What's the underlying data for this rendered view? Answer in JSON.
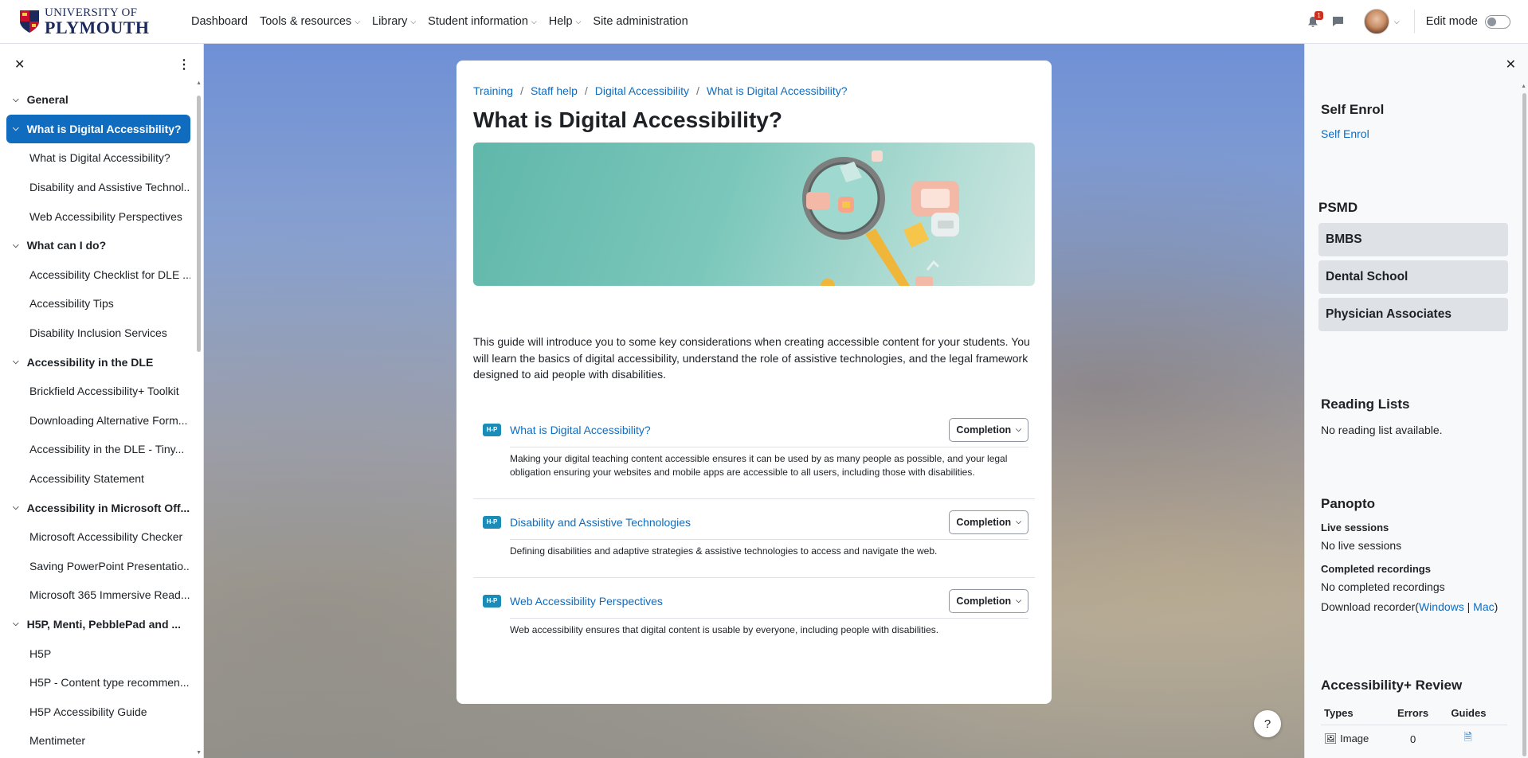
{
  "navbar": {
    "logo_line1": "UNIVERSITY OF",
    "logo_line2": "PLYMOUTH",
    "items": [
      {
        "label": "Dashboard",
        "dropdown": false
      },
      {
        "label": "Tools & resources",
        "dropdown": true
      },
      {
        "label": "Library",
        "dropdown": true
      },
      {
        "label": "Student information",
        "dropdown": true
      },
      {
        "label": "Help",
        "dropdown": true
      },
      {
        "label": "Site administration",
        "dropdown": false
      }
    ],
    "notification_count": "1",
    "edit_mode_label": "Edit mode"
  },
  "course_index": {
    "sections": [
      {
        "title": "General",
        "active": false,
        "items": []
      },
      {
        "title": "What is Digital Accessibility?",
        "active": true,
        "items": [
          "What is Digital Accessibility?",
          "Disability and Assistive Technol...",
          "Web Accessibility Perspectives"
        ]
      },
      {
        "title": "What can I do?",
        "active": false,
        "items": [
          "Accessibility Checklist for DLE ...",
          "Accessibility Tips",
          "Disability Inclusion Services"
        ]
      },
      {
        "title": "Accessibility in the DLE",
        "active": false,
        "items": [
          "Brickfield Accessibility+ Toolkit",
          "Downloading Alternative Form...",
          "Accessibility in the DLE - Tiny...",
          "Accessibility Statement"
        ]
      },
      {
        "title": "Accessibility in Microsoft Off...",
        "active": false,
        "items": [
          "Microsoft Accessibility Checker",
          "Saving PowerPoint Presentatio...",
          "Microsoft 365 Immersive Read..."
        ]
      },
      {
        "title": "H5P, Menti, PebblePad and ...",
        "active": false,
        "items": [
          "H5P",
          "H5P - Content type recommen...",
          "H5P Accessibility Guide",
          "Mentimeter"
        ]
      }
    ]
  },
  "main": {
    "breadcrumb": [
      "Training",
      "Staff help",
      "Digital Accessibility",
      "What is Digital Accessibility?"
    ],
    "title": "What is Digital Accessibility?",
    "intro": "This guide will introduce you to some key considerations when creating accessible content for your students. You will learn the basics of digital accessibility, understand the role of assistive technologies, and the legal framework designed to aid people with disabilities.",
    "activity_icon_label": "H-P",
    "completion_label": "Completion",
    "activities": [
      {
        "name": "What is Digital Accessibility?",
        "description": "Making your digital teaching content accessible ensures it can be used by as many people as possible, and your legal obligation ensuring your websites and mobile apps are accessible to all users, including those with disabilities."
      },
      {
        "name": "Disability and Assistive Technologies",
        "description": "Defining disabilities and adaptive strategies & assistive technologies to access and navigate the web."
      },
      {
        "name": "Web Accessibility Perspectives",
        "description": "Web accessibility ensures that digital content is usable by everyone, including people with disabilities."
      }
    ]
  },
  "help_button": "?",
  "blocks": {
    "self_enrol": {
      "title": "Self Enrol",
      "link": "Self Enrol"
    },
    "psmd": {
      "title": "PSMD",
      "buttons": [
        "BMBS",
        "Dental School",
        "Physician Associates"
      ]
    },
    "reading_lists": {
      "title": "Reading Lists",
      "text": "No reading list available."
    },
    "panopto": {
      "title": "Panopto",
      "live_heading": "Live sessions",
      "live_text": "No live sessions",
      "completed_heading": "Completed recordings",
      "completed_text": "No completed recordings",
      "download_prefix": "Download recorder(",
      "windows": "Windows",
      "separator": " | ",
      "mac": "Mac",
      "download_suffix": ")"
    },
    "accessibility_review": {
      "title": "Accessibility+ Review",
      "columns": [
        "Types",
        "Errors",
        "Guides"
      ],
      "rows": [
        {
          "type": "Image",
          "errors": "0"
        }
      ]
    }
  },
  "colors": {
    "accent": "#0f6cbf",
    "psmd_button_bg": "#dee2e6",
    "h5p_badge": "#1a8cb7"
  }
}
